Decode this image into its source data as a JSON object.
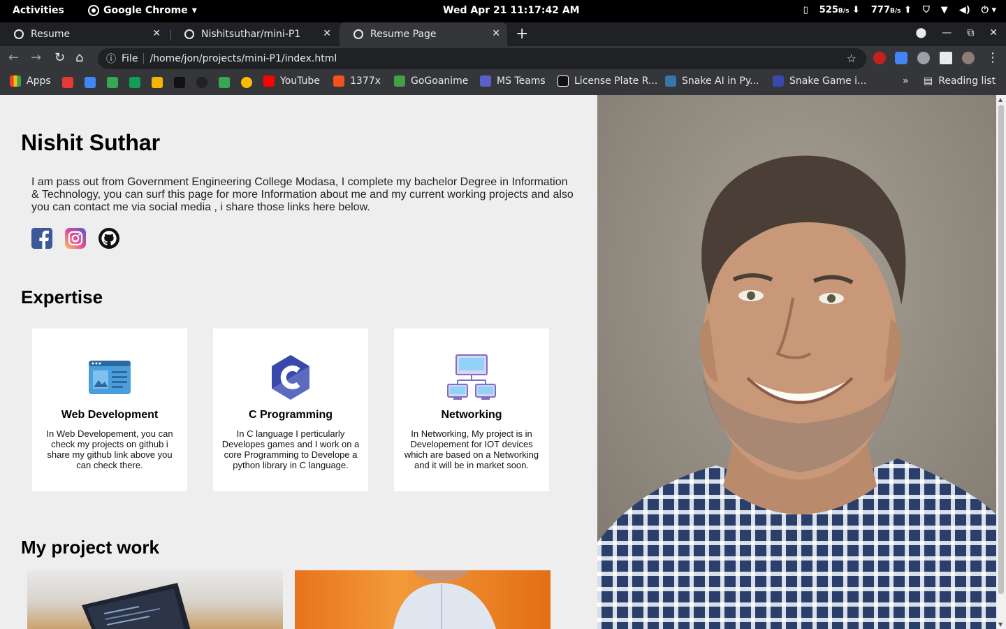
{
  "system": {
    "activities": "Activities",
    "app_name": "Google Chrome",
    "clock": "Wed Apr 21  11:17:42 AM",
    "net_down": "525",
    "net_down_unit": "B/s",
    "net_up": "777",
    "net_up_unit": "B/s"
  },
  "tabs": [
    {
      "title": "Resume"
    },
    {
      "title": "Nishitsuthar/mini-P1"
    },
    {
      "title": "Resume Page"
    }
  ],
  "address": {
    "scheme": "File",
    "path": "/home/jon/projects/mini-P1/index.html"
  },
  "bookmarks": {
    "apps": "Apps",
    "items": [
      "YouTube",
      "1377x",
      "GoGoanime",
      "MS Teams",
      "License Plate R...",
      "Snake AI in Py...",
      "Snake Game i..."
    ],
    "overflow": "»",
    "reading_list": "Reading list"
  },
  "page": {
    "name": "Nishit Suthar",
    "about": "I am pass out from Government Engineering College Modasa, I complete my bachelor Degree in Information & Technology, you can surf this page for more Information about me and my current working projects and also you can contact me via social media , i share those links here below.",
    "expertise_heading": "Expertise",
    "cards": [
      {
        "title": "Web Development",
        "desc": "In Web Developement, you can check my projects on github i share my github link above you can check there."
      },
      {
        "title": "C Programming",
        "desc": "In C language I perticularly Developes games and I work on a core Programming to Develope a python library in C language."
      },
      {
        "title": "Networking",
        "desc": "In Networking, My project is in Developement for IOT devices which are based on a Networking and it will be in market soon."
      }
    ],
    "projects_heading": "My project work"
  },
  "colors": {
    "page_bg": "#efeeee",
    "chrome_dark": "#202124",
    "chrome_toolbar": "#35363a",
    "facebook": "#3b5998",
    "card_bg": "#ffffff"
  }
}
